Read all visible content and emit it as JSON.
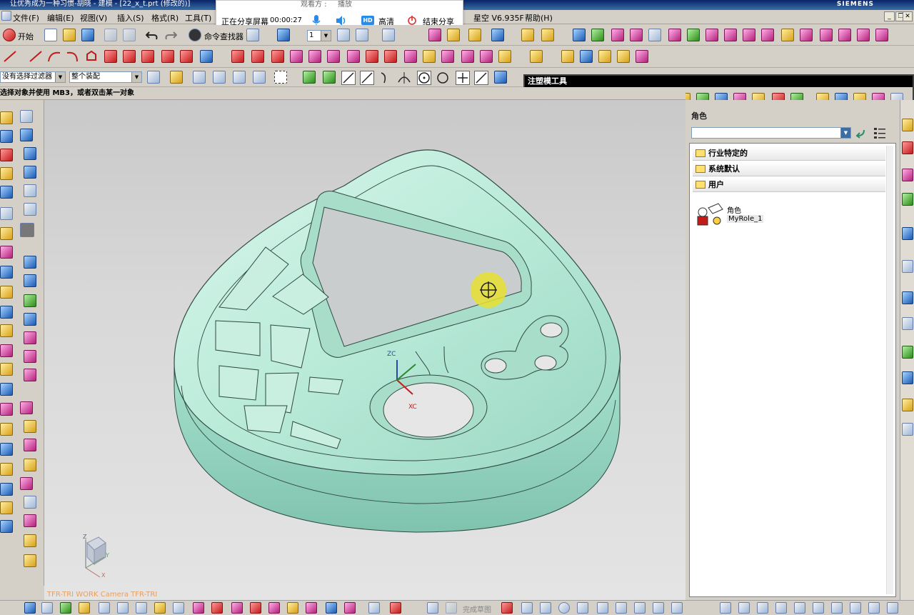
{
  "window": {
    "title": "让优秀成为一种习惯-胡晓 - 建模 - [22_x_t.prt (修改的)]",
    "brand": "SIEMENS"
  },
  "menu": [
    "文件(F)",
    "编辑(E)",
    "视图(V)",
    "插入(S)",
    "格式(R)",
    "工具(T)",
    "星空 V6.935F",
    "帮助(H)"
  ],
  "share_bar": {
    "top_text": "观看方 :",
    "top_text2": "播放",
    "status": "正在分享屏幕",
    "timer": "00:00:27",
    "quality_badge": "HD",
    "quality": "高清",
    "end": "结束分享"
  },
  "toolbar": {
    "start": "开始",
    "command_finder": "命令查找器",
    "layer_value": "1"
  },
  "selection": {
    "filter": "没有选择过滤器",
    "scope": "整个装配"
  },
  "status_prompt": "选择对象并使用 MB3，或者双击某一对象",
  "floating_toolbar": {
    "title": "注塑模工具"
  },
  "viewport": {
    "wcs_label": "TFR-TRI WORK Camera TFR-TRI",
    "axis_zc": "ZC",
    "axis_xc": "XC",
    "triad": [
      "Z",
      "X",
      "Y"
    ]
  },
  "roles_panel": {
    "title": "角色",
    "folders": [
      "行业特定的",
      "系统默认",
      "用户"
    ],
    "role_heading": "角色",
    "role_name": "MyRole_1"
  },
  "bottom": {
    "sketch_done": "完成草图"
  },
  "colors": {
    "part": "#b9ead8",
    "part_edge": "#2f4a44",
    "screen": "#c9cdcd",
    "cursor_highlight": "#e8e030"
  }
}
